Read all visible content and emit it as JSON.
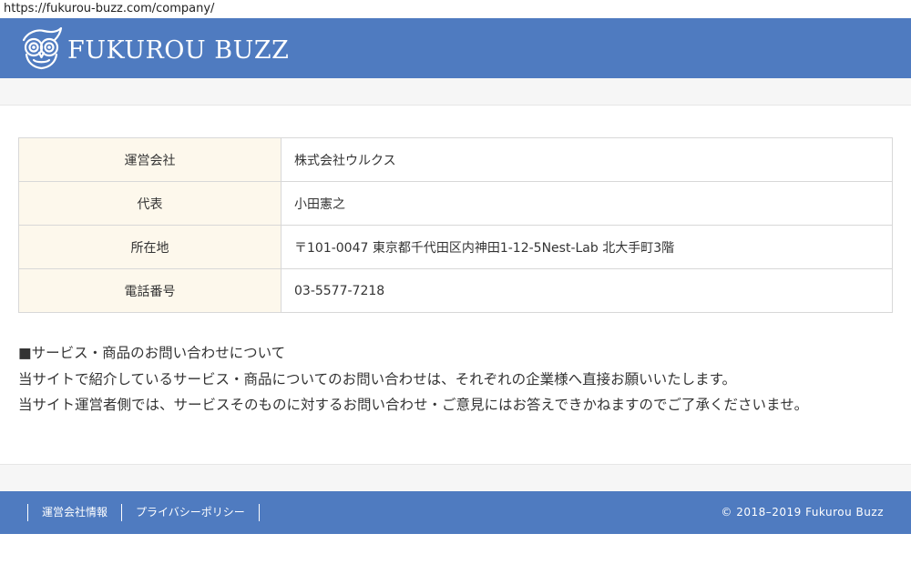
{
  "browser": {
    "url": "https://fukurou-buzz.com/company/"
  },
  "header": {
    "logo_icon": "owl-logo-icon",
    "logo_text": "FUKUROU BUZZ",
    "background_color": "#4f7bc0"
  },
  "company_info": {
    "rows": [
      {
        "label": "運営会社",
        "value": "株式会社ウルクス"
      },
      {
        "label": "代表",
        "value": "小田憲之"
      },
      {
        "label": "所在地",
        "value": "〒101-0047 東京都千代田区内神田1-12-5Nest-Lab 北大手町3階"
      },
      {
        "label": "電話番号",
        "value": "03-5577-7218"
      }
    ],
    "label_background_color": "#fdf8ec"
  },
  "notice": {
    "heading": "■サービス・商品のお問い合わせについて",
    "line1": "当サイトで紹介しているサービス・商品についてのお問い合わせは、それぞれの企業様へ直接お願いいたします。",
    "line2": "当サイト運営者側では、サービスそのものに対するお問い合わせ・ご意見にはお答えできかねますのでご了承くださいませ。"
  },
  "footer": {
    "links": [
      {
        "label": "運営会社情報"
      },
      {
        "label": "プライバシーポリシー"
      }
    ],
    "copyright": "© 2018–2019  Fukurou Buzz",
    "background_color": "#4f7bc0"
  }
}
